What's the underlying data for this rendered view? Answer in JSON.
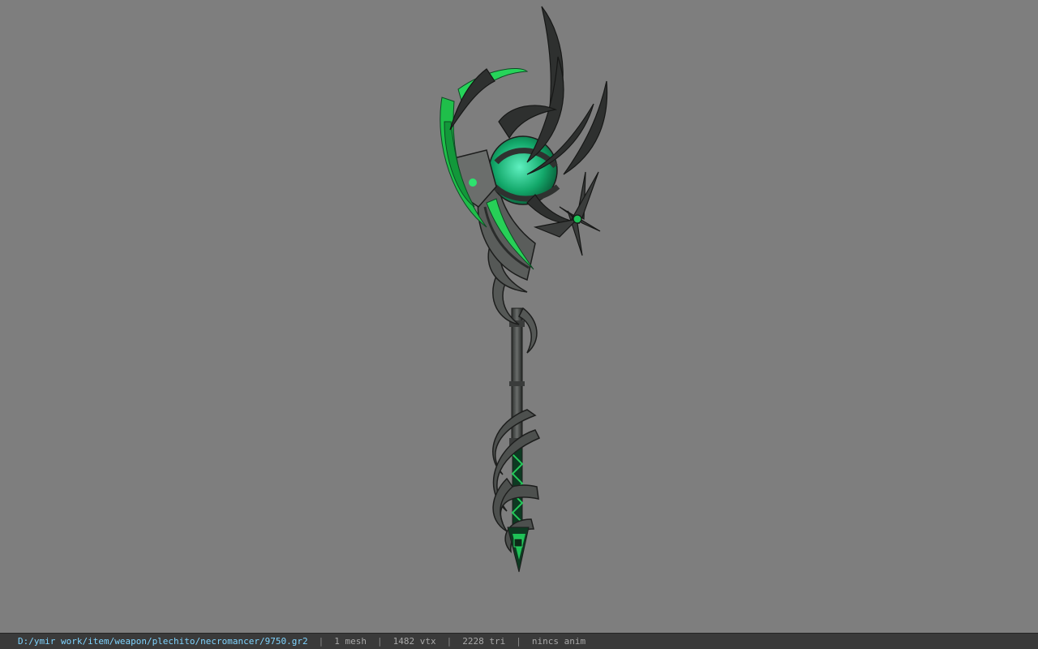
{
  "status_bar": {
    "file_path": "D:/ymir work/item/weapon/plechito/necromancer/9750.gr2",
    "separator": "|",
    "mesh_count": "1 mesh",
    "vertex_count": "1482 vtx",
    "triangle_count": "2228 tri",
    "animation": "nincs anim"
  },
  "colors": {
    "viewport_background": "#7e7e7e",
    "status_background": "#3a3a3a",
    "path_text": "#7fd4ff",
    "accent_green": "#1fc14a"
  }
}
